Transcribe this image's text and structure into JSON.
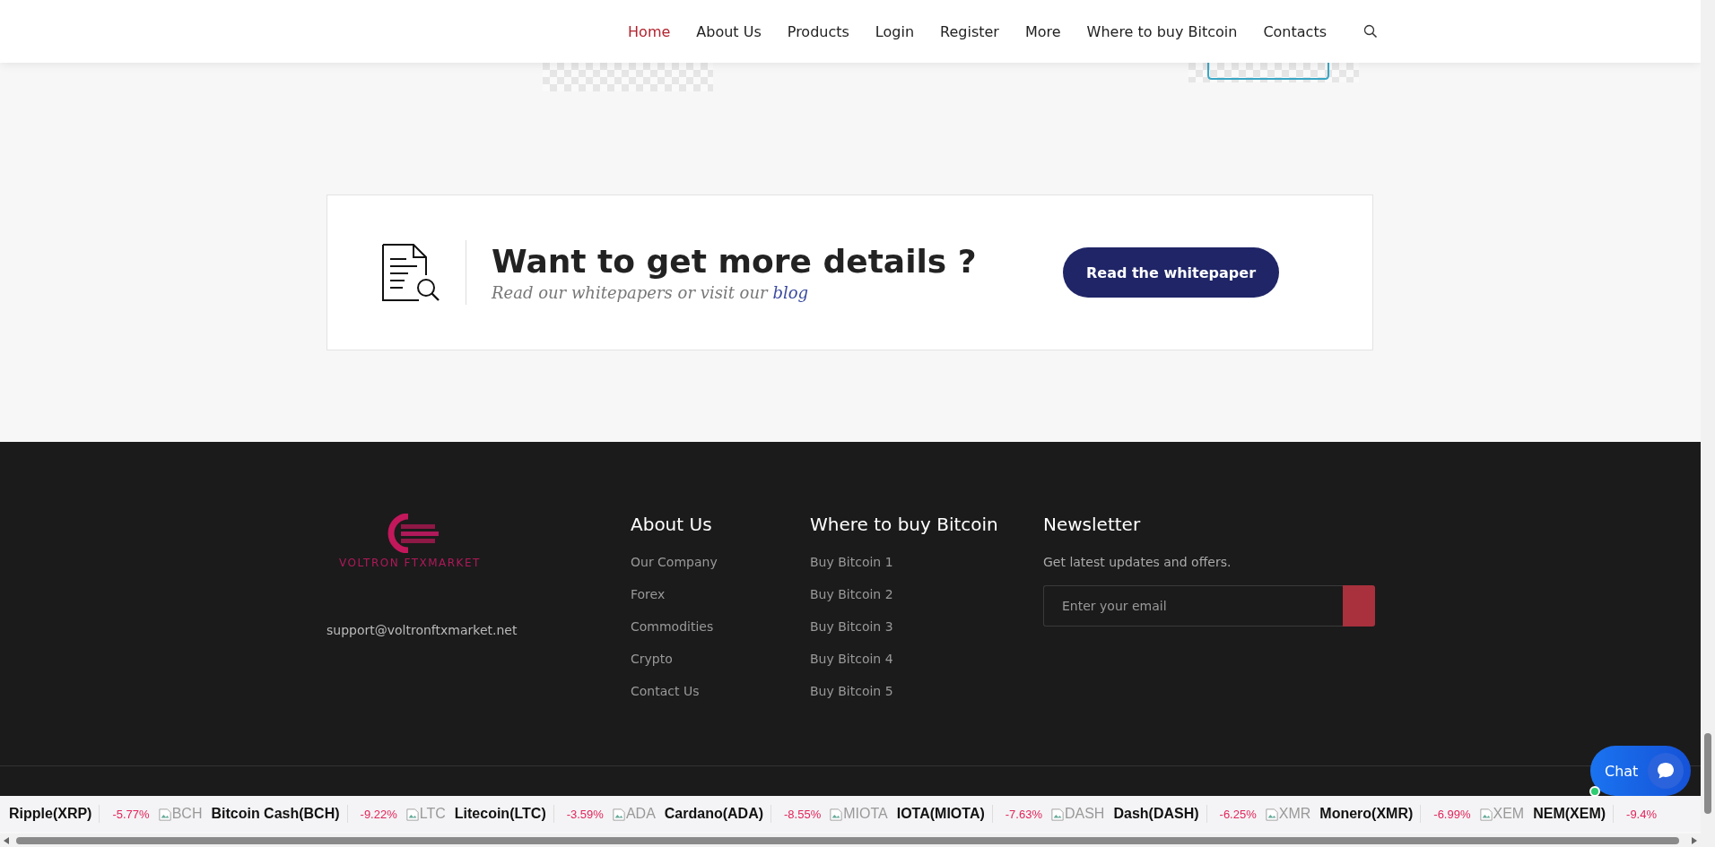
{
  "nav": {
    "items": [
      {
        "label": "Home",
        "selected": true
      },
      {
        "label": "About Us",
        "selected": false
      },
      {
        "label": "Products",
        "selected": false
      },
      {
        "label": "Login",
        "selected": false
      },
      {
        "label": "Register",
        "selected": false
      },
      {
        "label": "More",
        "selected": false
      },
      {
        "label": "Where to buy Bitcoin",
        "selected": false
      },
      {
        "label": "Contacts",
        "selected": false
      }
    ]
  },
  "cta": {
    "title": "Want to get more details ?",
    "subtitle": "Read our whitepapers or visit our",
    "link": "blog",
    "button": "Read the whitepaper"
  },
  "footer": {
    "logo_text": "VOLTRON FTXMARKET",
    "email": "support@voltronftxmarket.net",
    "columns": [
      {
        "heading": "About Us",
        "links": [
          "Our Company",
          "Forex",
          "Commodities",
          "Crypto",
          "Contact Us"
        ]
      },
      {
        "heading": "Where to buy Bitcoin",
        "links": [
          "Buy Bitcoin 1",
          "Buy Bitcoin 2",
          "Buy Bitcoin 3",
          "Buy Bitcoin 4",
          "Buy Bitcoin 5"
        ]
      }
    ],
    "newsletter": {
      "heading": "Newsletter",
      "text": "Get latest updates and offers.",
      "placeholder": "Enter your email"
    }
  },
  "ticker": [
    {
      "name": "Ripple(XRP)",
      "change": "-5.77%"
    },
    {
      "icon_alt": "BCH",
      "name": "Bitcoin Cash(BCH)",
      "change": "-9.22%"
    },
    {
      "icon_alt": "LTC",
      "name": "Litecoin(LTC)",
      "change": "-3.59%"
    },
    {
      "icon_alt": "ADA",
      "name": "Cardano(ADA)",
      "change": "-8.55%"
    },
    {
      "icon_alt": "MIOTA",
      "name": "IOTA(MIOTA)",
      "change": "-7.63%"
    },
    {
      "icon_alt": "DASH",
      "name": "Dash(DASH)",
      "change": "-6.25%"
    },
    {
      "icon_alt": "XMR",
      "name": "Monero(XMR)",
      "change": "-6.99%"
    },
    {
      "icon_alt": "XEM",
      "name": "NEM(XEM)",
      "change": "-9.4%"
    }
  ],
  "chat": {
    "label": "Chat"
  }
}
